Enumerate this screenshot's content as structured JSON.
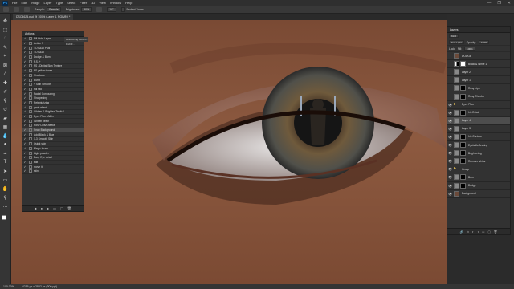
{
  "app": {
    "logo": "Ps"
  },
  "menu": [
    "File",
    "Edit",
    "Image",
    "Layer",
    "Type",
    "Select",
    "Filter",
    "3D",
    "View",
    "Window",
    "Help"
  ],
  "window_controls": [
    "—",
    "❐",
    "✕"
  ],
  "options": {
    "mode_label": "Sample:",
    "mode_value": "Sample",
    "sample_label": "Brightness:",
    "sample_value": "50%",
    "tolerance_value": "10°",
    "protect_label": "Protect Tones"
  },
  "document": {
    "tab_title": "DSC4624.psd @ 100% (Layer 4, RGB/8*) *"
  },
  "statusbar": {
    "zoom": "100.00%",
    "doc_info": "4256 px x 2832 px (300 ppi)"
  },
  "actions_panel": {
    "title": "Actions",
    "set_label": "Retouching Actions - Rich F…",
    "items": [
      "Fill Hole Layer",
      "Action 5",
      "TO B&W Plus",
      "TO B&W",
      "Dodge & Burn",
      "F.S. +",
      "FS - Digital Skin Texture",
      "FS yellow tones",
      "Shadows",
      "Burnt",
      "+ Skin Smooth",
      "full rad",
      "Facial Contouring",
      "Sharpening",
      "Retexturizing",
      "grain effect",
      "Whiten & Brighten Teeth 1…",
      "Eyes Plus - All in",
      "Whiten Teeth",
      "Rosy Lips/Cheeks",
      "Snap Background",
      "Add Black & Blue",
      "1-3 Smooth Skin",
      "Quick skin",
      "Magic brush",
      "Light powder",
      "Easy Eye detail",
      "edit",
      "move it",
      "skin"
    ],
    "selected_index": 20,
    "footer_icons": [
      "■",
      "●",
      "▶",
      "▭",
      "▢",
      "🗑"
    ]
  },
  "layers_panel": {
    "title": "Layers",
    "kind_label": "Kind",
    "blend_mode": "Soft Light",
    "opacity_label": "Opacity:",
    "opacity_value": "100%",
    "lock_label": "Lock:",
    "fill_label": "Fill:",
    "fill_value": "100%",
    "layers": [
      {
        "name": "DODGE",
        "thumb": "img",
        "mask": "",
        "visible": false,
        "indent": false
      },
      {
        "name": "Black & White 1",
        "thumb": "adj",
        "mask": "white",
        "visible": false,
        "indent": false
      },
      {
        "name": "Layer 2",
        "thumb": "grey",
        "mask": "",
        "visible": false,
        "indent": false
      },
      {
        "name": "Layer 1",
        "thumb": "grey",
        "mask": "",
        "visible": false,
        "indent": false
      },
      {
        "name": "Rosy Lips",
        "thumb": "grey",
        "mask": "black",
        "visible": false,
        "indent": false
      },
      {
        "name": "Rosy Cheeks",
        "thumb": "grey",
        "mask": "black",
        "visible": false,
        "indent": false
      },
      {
        "name": "Eyes Plus",
        "thumb": "folder",
        "mask": "",
        "visible": true,
        "indent": false
      },
      {
        "name": "Iris Detail",
        "thumb": "grey",
        "mask": "black",
        "visible": true,
        "indent": true
      },
      {
        "name": "Layer 4",
        "thumb": "grey",
        "mask": "",
        "visible": true,
        "indent": true
      },
      {
        "name": "Layer 3",
        "thumb": "grey",
        "mask": "",
        "visible": true,
        "indent": true
      },
      {
        "name": "Iris Contour",
        "thumb": "grey",
        "mask": "black",
        "visible": true,
        "indent": true
      },
      {
        "name": "Eyeballs Jeering",
        "thumb": "grey",
        "mask": "black",
        "visible": true,
        "indent": true
      },
      {
        "name": "Brightening",
        "thumb": "grey",
        "mask": "black",
        "visible": true,
        "indent": true
      },
      {
        "name": "Remove Veins",
        "thumb": "grey",
        "mask": "black",
        "visible": true,
        "indent": true
      },
      {
        "name": "Group",
        "thumb": "folder",
        "mask": "",
        "visible": true,
        "indent": false
      },
      {
        "name": "Burn",
        "thumb": "grey",
        "mask": "black",
        "visible": true,
        "indent": false
      },
      {
        "name": "Dodge",
        "thumb": "grey",
        "mask": "black",
        "visible": true,
        "indent": false
      },
      {
        "name": "Background",
        "thumb": "img",
        "mask": "",
        "visible": true,
        "indent": false
      }
    ],
    "selected_index": 8,
    "footer_icons": [
      "🔗",
      "fx",
      "◐",
      "◑",
      "▭",
      "▢",
      "🗑"
    ]
  }
}
